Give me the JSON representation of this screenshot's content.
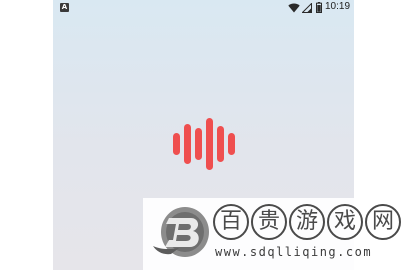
{
  "status_bar": {
    "notification_icon": "A",
    "time": "10:19",
    "icons": [
      "wifi-icon",
      "signal-icon",
      "battery-icon"
    ]
  },
  "splash": {
    "logo_icon": "audio-waveform-icon",
    "logo_color": "#ef4f4f",
    "background_top": "#d9e8f2",
    "background_bottom": "#e6e5ea"
  },
  "watermark": {
    "title_chars": [
      "百",
      "贵",
      "游",
      "戏",
      "网"
    ],
    "url": "www.sdqlliqing.com",
    "logo_icon": "b-letter-logo"
  }
}
